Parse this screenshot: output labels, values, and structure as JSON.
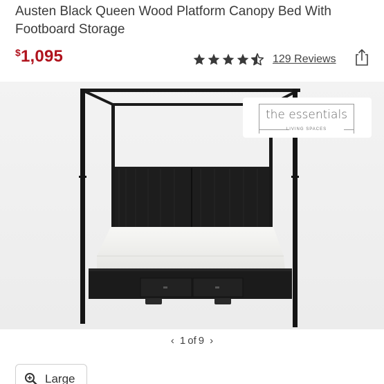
{
  "product": {
    "title": "Austen Black Queen Wood Platform Canopy Bed With Footboard Storage",
    "price_symbol": "$",
    "price_value": "1,095",
    "rating": 4.5,
    "reviews_label": "129 Reviews"
  },
  "gallery": {
    "badge_title": "the essentials",
    "badge_sub": "LIVING SPACES",
    "pager_current": "1",
    "pager_of": "of",
    "pager_total": "9",
    "prev_arrow": "‹",
    "next_arrow": "›"
  },
  "zoom": {
    "label": "Large",
    "icon": "zoom-in-icon"
  },
  "colors": {
    "price": "#b0131d",
    "gallery_bg": "#f3f3f3",
    "bed_frame": "#1a1a1a",
    "mattress": "#f2f2f0"
  }
}
